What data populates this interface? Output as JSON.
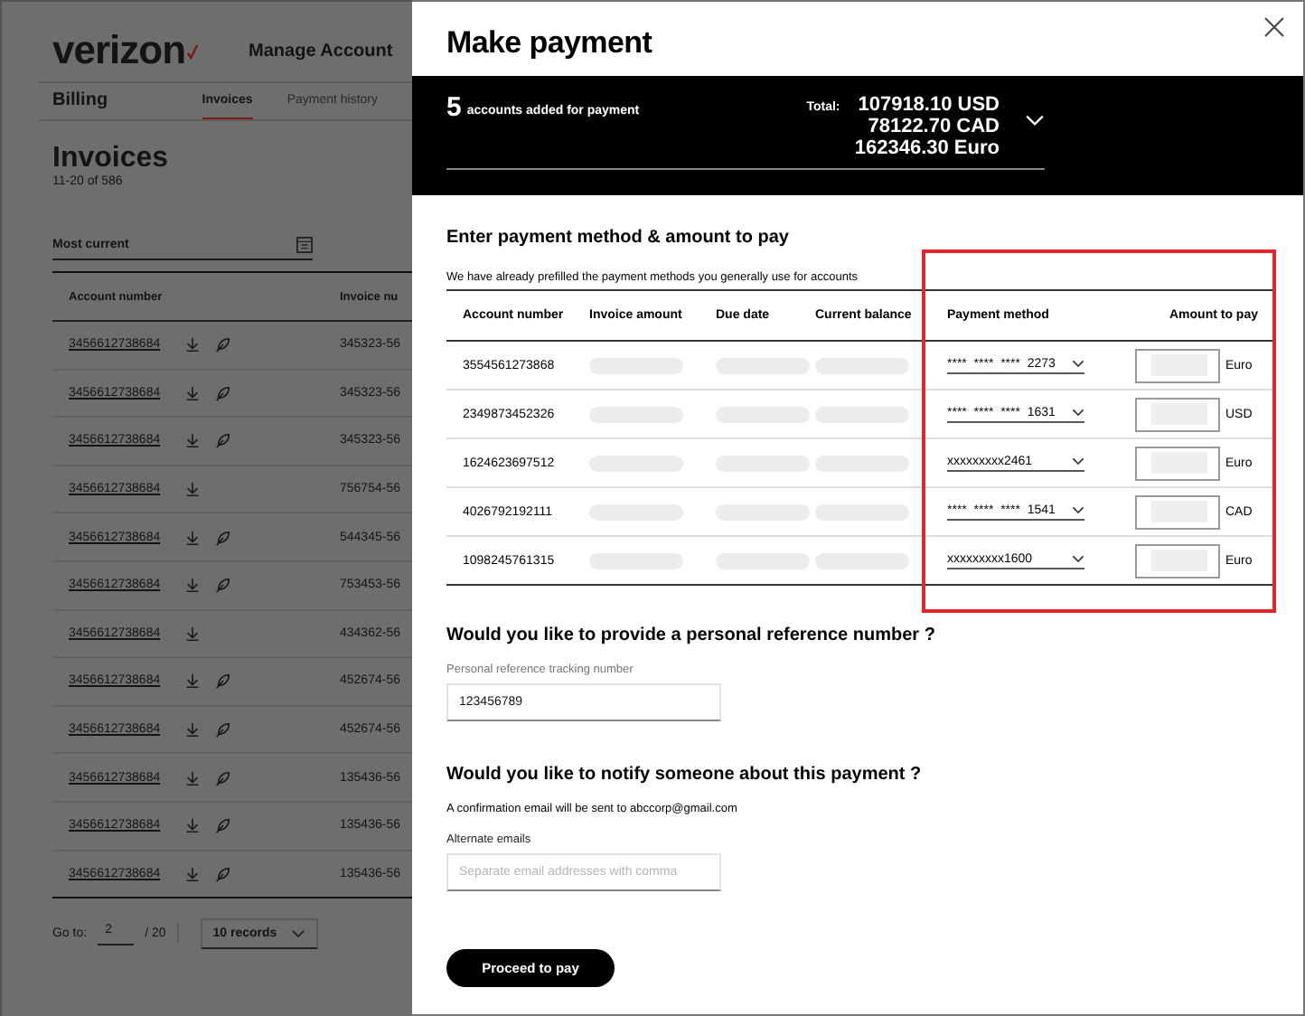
{
  "background": {
    "logo": "verizon",
    "header_title": "Manage Account",
    "section": "Billing",
    "tabs": [
      {
        "label": "Invoices",
        "selected": true
      },
      {
        "label": "Payment history",
        "selected": false
      }
    ],
    "page_title": "Invoices",
    "range": "11-20 of 586",
    "sort": "Most current",
    "columns": [
      "Account number",
      "Invoice nu"
    ],
    "rows": [
      {
        "account": "3456612738684",
        "paperless": true,
        "invoice": "345323-56"
      },
      {
        "account": "3456612738684",
        "paperless": true,
        "invoice": "345323-56"
      },
      {
        "account": "3456612738684",
        "paperless": true,
        "invoice": "345323-56"
      },
      {
        "account": "3456612738684",
        "paperless": false,
        "invoice": "756754-56"
      },
      {
        "account": "3456612738684",
        "paperless": true,
        "invoice": "544345-56"
      },
      {
        "account": "3456612738684",
        "paperless": true,
        "invoice": "753453-56"
      },
      {
        "account": "3456612738684",
        "paperless": false,
        "invoice": "434362-56"
      },
      {
        "account": "3456612738684",
        "paperless": true,
        "invoice": "452674-56"
      },
      {
        "account": "3456612738684",
        "paperless": true,
        "invoice": "452674-56"
      },
      {
        "account": "3456612738684",
        "paperless": true,
        "invoice": "135436-56"
      },
      {
        "account": "3456612738684",
        "paperless": true,
        "invoice": "135436-56"
      },
      {
        "account": "3456612738684",
        "paperless": true,
        "invoice": "135436-56"
      }
    ],
    "pagination": {
      "goto_label": "Go to:",
      "page": "2",
      "total": "/ 20",
      "per_page": "10 records"
    }
  },
  "modal": {
    "title": "Make payment",
    "summary": {
      "count": "5",
      "label": "accounts added for payment",
      "total_label": "Total:",
      "totals": [
        "107918.10 USD",
        "78122.70 CAD",
        "162346.30 Euro"
      ]
    },
    "section_title": "Enter payment method & amount to pay",
    "hint": "We have already prefilled the payment methods you generally use for accounts",
    "columns": [
      "Account number",
      "Invoice amount",
      "Due date",
      "Current balance",
      "Payment method",
      "Amount to pay"
    ],
    "rows": [
      {
        "account": "3554561273868",
        "method": "****  ****  ****  2273",
        "currency": "Euro"
      },
      {
        "account": "2349873452326",
        "method": "****  ****  ****  1631",
        "currency": "USD"
      },
      {
        "account": "1624623697512",
        "method": "xxxxxxxxx2461",
        "currency": "Euro"
      },
      {
        "account": "4026792192111",
        "method": "****  ****  ****  1541",
        "currency": "CAD"
      },
      {
        "account": "1098245761315",
        "method": "xxxxxxxxx1600",
        "currency": "Euro"
      }
    ],
    "reference": {
      "question": "Would you like to provide a personal reference number ?",
      "label": "Personal reference tracking number",
      "value": "123456789"
    },
    "notify": {
      "question": "Would you like to notify someone about this payment ?",
      "note": "A confirmation email will be sent to abccorp@gmail.com",
      "label": "Alternate emails",
      "placeholder": "Separate email addresses with comma"
    },
    "proceed": "Proceed to pay"
  }
}
